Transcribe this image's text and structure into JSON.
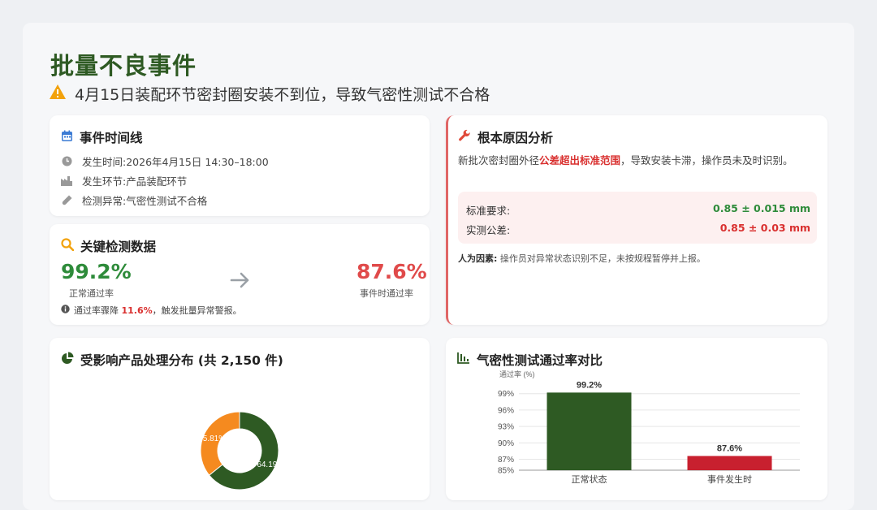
{
  "header": {
    "title": "批量不良事件",
    "subtitle": "4月15日装配环节密封圈安装不到位，导致气密性测试不合格"
  },
  "timeline": {
    "title": "事件时间线",
    "items": [
      {
        "label": "发生时间:",
        "value": "2026年4月15日 14:30–18:00"
      },
      {
        "label": "发生环节:",
        "value": "产品装配环节"
      },
      {
        "label": "检测异常:",
        "value": "气密性测试不合格"
      }
    ]
  },
  "key_data": {
    "title": "关键检测数据",
    "normal_value": "99.2%",
    "normal_label": "正常通过率",
    "event_value": "87.6%",
    "event_label": "事件时通过率",
    "note_prefix": "通过率骤降",
    "note_drop": "11.6%",
    "note_suffix": "，触发批量异常警报。"
  },
  "root_cause": {
    "title": "根本原因分析",
    "text_prefix": "新批次密封圈外径",
    "text_highlight": "公差超出标准范围",
    "text_suffix": "，导致安装卡滞，操作员未及时识别。",
    "standard_label": "标准要求:",
    "standard_value": "0.85 ± 0.015 mm",
    "actual_label": "实测公差:",
    "actual_value": "0.85 ± 0.03 mm",
    "human_label": "人为因素:",
    "human_text": "操作员对异常状态识别不足，未按规程暂停并上报。"
  },
  "distribution": {
    "title": "受影响产品处理分布 (共 2,150 件)"
  },
  "comparison": {
    "title": "气密性测试通过率对比"
  },
  "colors": {
    "title_green": "#2e5a23",
    "bar_green": "#2e5a23",
    "bar_red": "#c8202f",
    "donut_orange": "#f58a1f",
    "accent_red": "#e06666"
  },
  "chart_data": [
    {
      "type": "pie",
      "title": "受影响产品处理分布 (共 2,150 件)",
      "slices": [
        {
          "label": "",
          "value": 64.19,
          "text": "64.19",
          "color": "#2e5a23"
        },
        {
          "label": "",
          "value": 35.81,
          "text": "35.81%",
          "color": "#f58a1f"
        }
      ],
      "donut": true
    },
    {
      "type": "bar",
      "title": "气密性测试通过率对比",
      "categories": [
        "正常状态",
        "事件发生时"
      ],
      "values": [
        99.2,
        87.6
      ],
      "value_labels": [
        "99.2%",
        "87.6%"
      ],
      "colors": [
        "#2e5a23",
        "#c8202f"
      ],
      "ylabel": "通过率 (%)",
      "ylim": [
        85,
        100
      ],
      "yticks": [
        85,
        87,
        90,
        93,
        96,
        99
      ],
      "ytick_labels": [
        "85%",
        "87%",
        "90%",
        "93%",
        "96%",
        "99%"
      ],
      "grid": true
    }
  ]
}
